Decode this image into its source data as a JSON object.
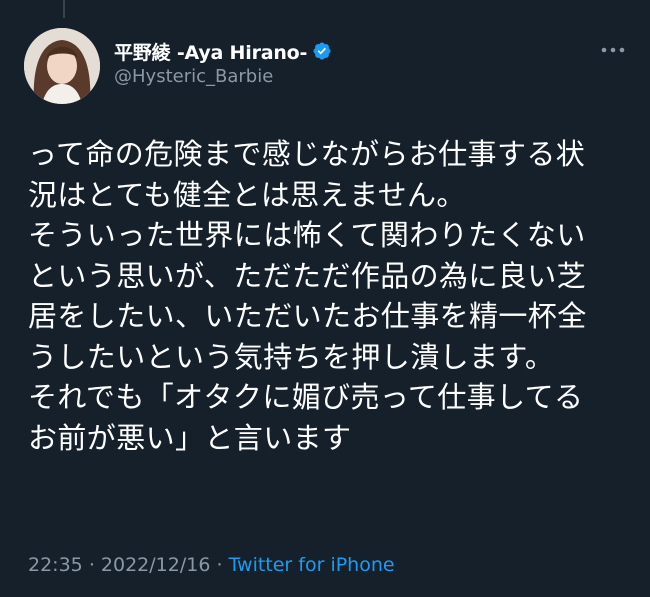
{
  "author": {
    "display_name": "平野綾 -Aya Hirano-",
    "handle": "@Hysteric_Barbie",
    "verified": true
  },
  "tweet": {
    "lines": [
      "って命の危険まで感じながらお仕事する状",
      "況はとても健全とは思えません。",
      "そういった世界には怖くて関わりたくない",
      "という思いが、ただただ作品の為に良い芝",
      "居をしたい、いただいたお仕事を精一杯全",
      "うしたいという気持ちを押し潰します。",
      "それでも「オタクに媚び売って仕事してる",
      "お前が悪い」と言います"
    ]
  },
  "meta": {
    "time": "22:35",
    "separator": "·",
    "date": "2022/12/16",
    "source": "Twitter for iPhone"
  },
  "icons": {
    "verified": "verified-badge-icon",
    "more": "more-horizontal-icon"
  },
  "colors": {
    "background": "#15202b",
    "text": "#ffffff",
    "secondary": "#8b98a5",
    "accent": "#1d9bf0"
  }
}
